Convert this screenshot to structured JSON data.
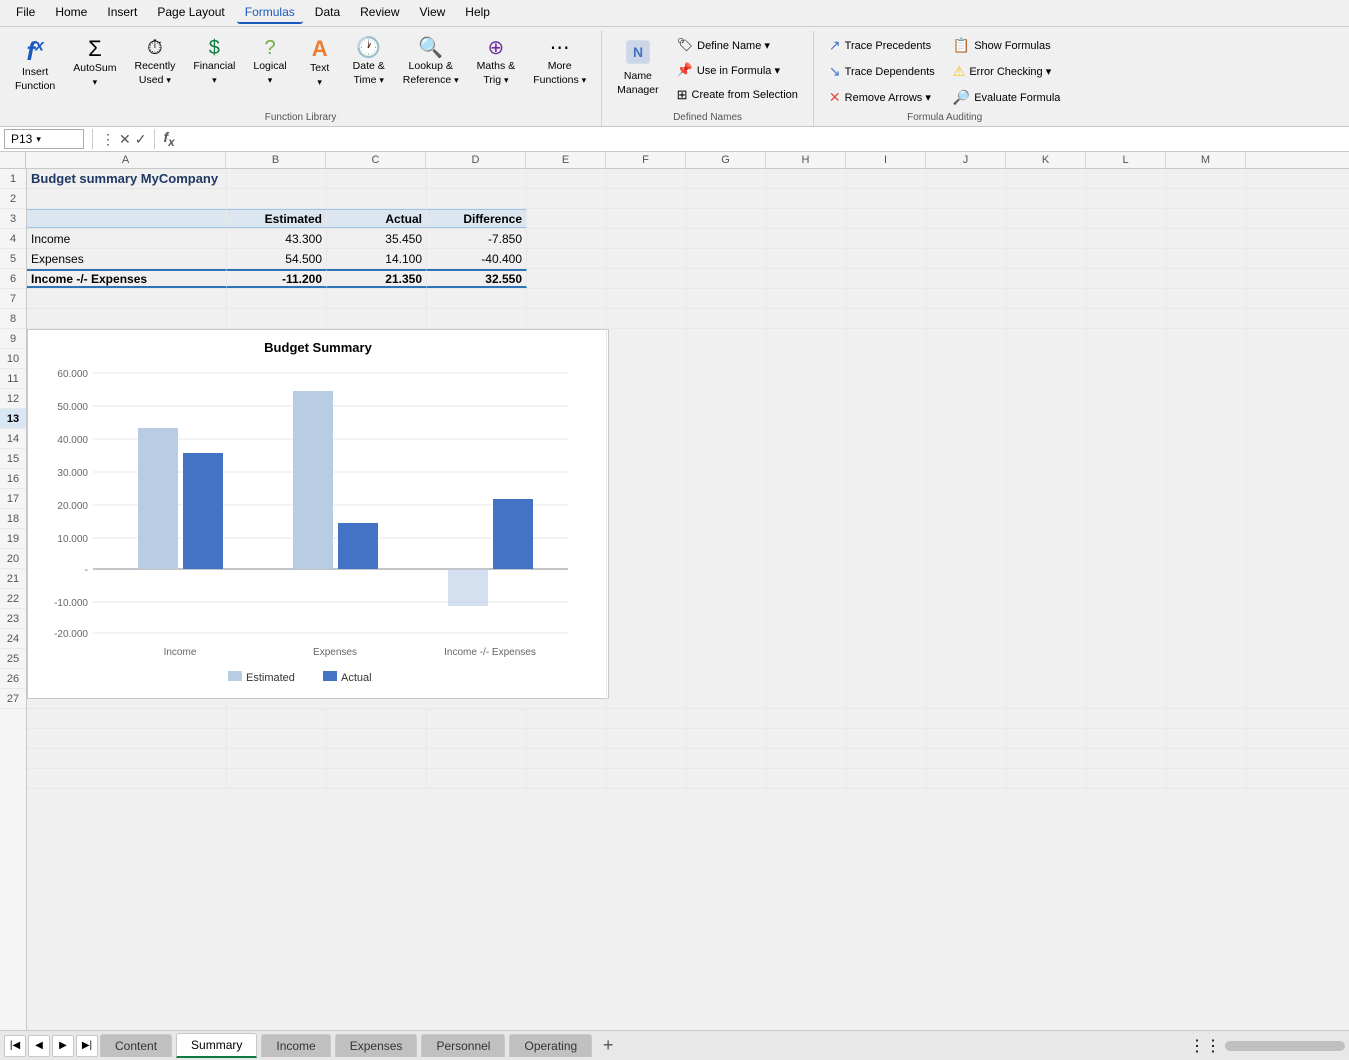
{
  "menu": {
    "items": [
      "File",
      "Home",
      "Insert",
      "Page Layout",
      "Formulas",
      "Data",
      "Review",
      "View",
      "Help"
    ],
    "active": "Formulas"
  },
  "ribbon": {
    "function_library": {
      "label": "Function Library",
      "buttons": [
        {
          "id": "insert-function",
          "icon": "fx",
          "label": "Insert\nFunction"
        },
        {
          "id": "autosum",
          "icon": "Σ",
          "label": "AutoSum"
        },
        {
          "id": "recently-used",
          "icon": "☆",
          "label": "Recently\nUsed"
        },
        {
          "id": "financial",
          "icon": "💲",
          "label": "Financial"
        },
        {
          "id": "logical",
          "icon": "?",
          "label": "Logical"
        },
        {
          "id": "text",
          "icon": "A",
          "label": "Text"
        },
        {
          "id": "date-time",
          "icon": "🕐",
          "label": "Date &\nTime"
        },
        {
          "id": "lookup-reference",
          "icon": "🔍",
          "label": "Lookup &\nReference"
        },
        {
          "id": "maths-trig",
          "icon": "⊕",
          "label": "Maths &\nTrig"
        },
        {
          "id": "more-functions",
          "icon": "⋯",
          "label": "More\nFunctions"
        }
      ]
    },
    "defined_names": {
      "label": "Defined Names",
      "buttons": [
        {
          "id": "name-manager",
          "icon": "📋",
          "label": "Name\nManager"
        },
        {
          "id": "define-name",
          "label": "Define Name ▾"
        },
        {
          "id": "use-in-formula",
          "label": "Use in Formula ▾"
        },
        {
          "id": "create-from-selection",
          "label": "Create from Selection"
        }
      ]
    },
    "formula_auditing": {
      "label": "Formula Auditing",
      "buttons": [
        {
          "id": "trace-precedents",
          "label": "Trace Precedents"
        },
        {
          "id": "trace-dependents",
          "label": "Trace Dependents"
        },
        {
          "id": "remove-arrows",
          "label": "Remove Arrows ▾"
        },
        {
          "id": "show-formulas",
          "label": "Show Formulas"
        },
        {
          "id": "error-checking",
          "label": "Error Checking ▾"
        },
        {
          "id": "evaluate-formula",
          "label": "Evaluate Formula"
        }
      ]
    }
  },
  "formula_bar": {
    "cell_ref": "P13",
    "formula_content": ""
  },
  "columns": [
    "A",
    "B",
    "C",
    "D",
    "E",
    "F",
    "G",
    "H",
    "I",
    "J",
    "K",
    "L",
    "M"
  ],
  "rows": [
    1,
    2,
    3,
    4,
    5,
    6,
    7,
    8,
    9,
    10,
    11,
    12,
    13,
    14,
    15,
    16,
    17,
    18,
    19,
    20,
    21,
    22,
    23,
    24,
    25,
    26,
    27
  ],
  "spreadsheet_title": "Budget summary MyCompany",
  "table": {
    "headers": [
      "",
      "Estimated",
      "Actual",
      "Difference"
    ],
    "rows": [
      {
        "label": "Income",
        "estimated": "43.300",
        "actual": "35.450",
        "difference": "-7.850",
        "bold": false
      },
      {
        "label": "Expenses",
        "estimated": "54.500",
        "actual": "14.100",
        "difference": "-40.400",
        "bold": false
      },
      {
        "label": "Income -/- Expenses",
        "estimated": "-11.200",
        "actual": "21.350",
        "difference": "32.550",
        "bold": true
      }
    ]
  },
  "chart": {
    "title": "Budget Summary",
    "y_axis_labels": [
      "60.000",
      "50.000",
      "40.000",
      "30.000",
      "20.000",
      "10.000",
      "-",
      "-10.000",
      "-20.000"
    ],
    "x_axis_labels": [
      "Income",
      "Expenses",
      "Income -/- Expenses"
    ],
    "legend": [
      "Estimated",
      "Actual"
    ],
    "data": {
      "estimated": [
        43.3,
        54.5,
        -11.2
      ],
      "actual": [
        35.45,
        14.1,
        21.35
      ]
    },
    "y_max": 60,
    "y_min": -20,
    "colors": {
      "estimated": "#b8cce4",
      "actual": "#4472c4"
    }
  },
  "tabs": [
    {
      "id": "content",
      "label": "Content",
      "active": false
    },
    {
      "id": "summary",
      "label": "Summary",
      "active": true
    },
    {
      "id": "income",
      "label": "Income",
      "active": false
    },
    {
      "id": "expenses",
      "label": "Expenses",
      "active": false
    },
    {
      "id": "personnel",
      "label": "Personnel",
      "active": false
    },
    {
      "id": "operating",
      "label": "Operating",
      "active": false
    }
  ],
  "selected_cell": "P13",
  "selected_row": 13
}
